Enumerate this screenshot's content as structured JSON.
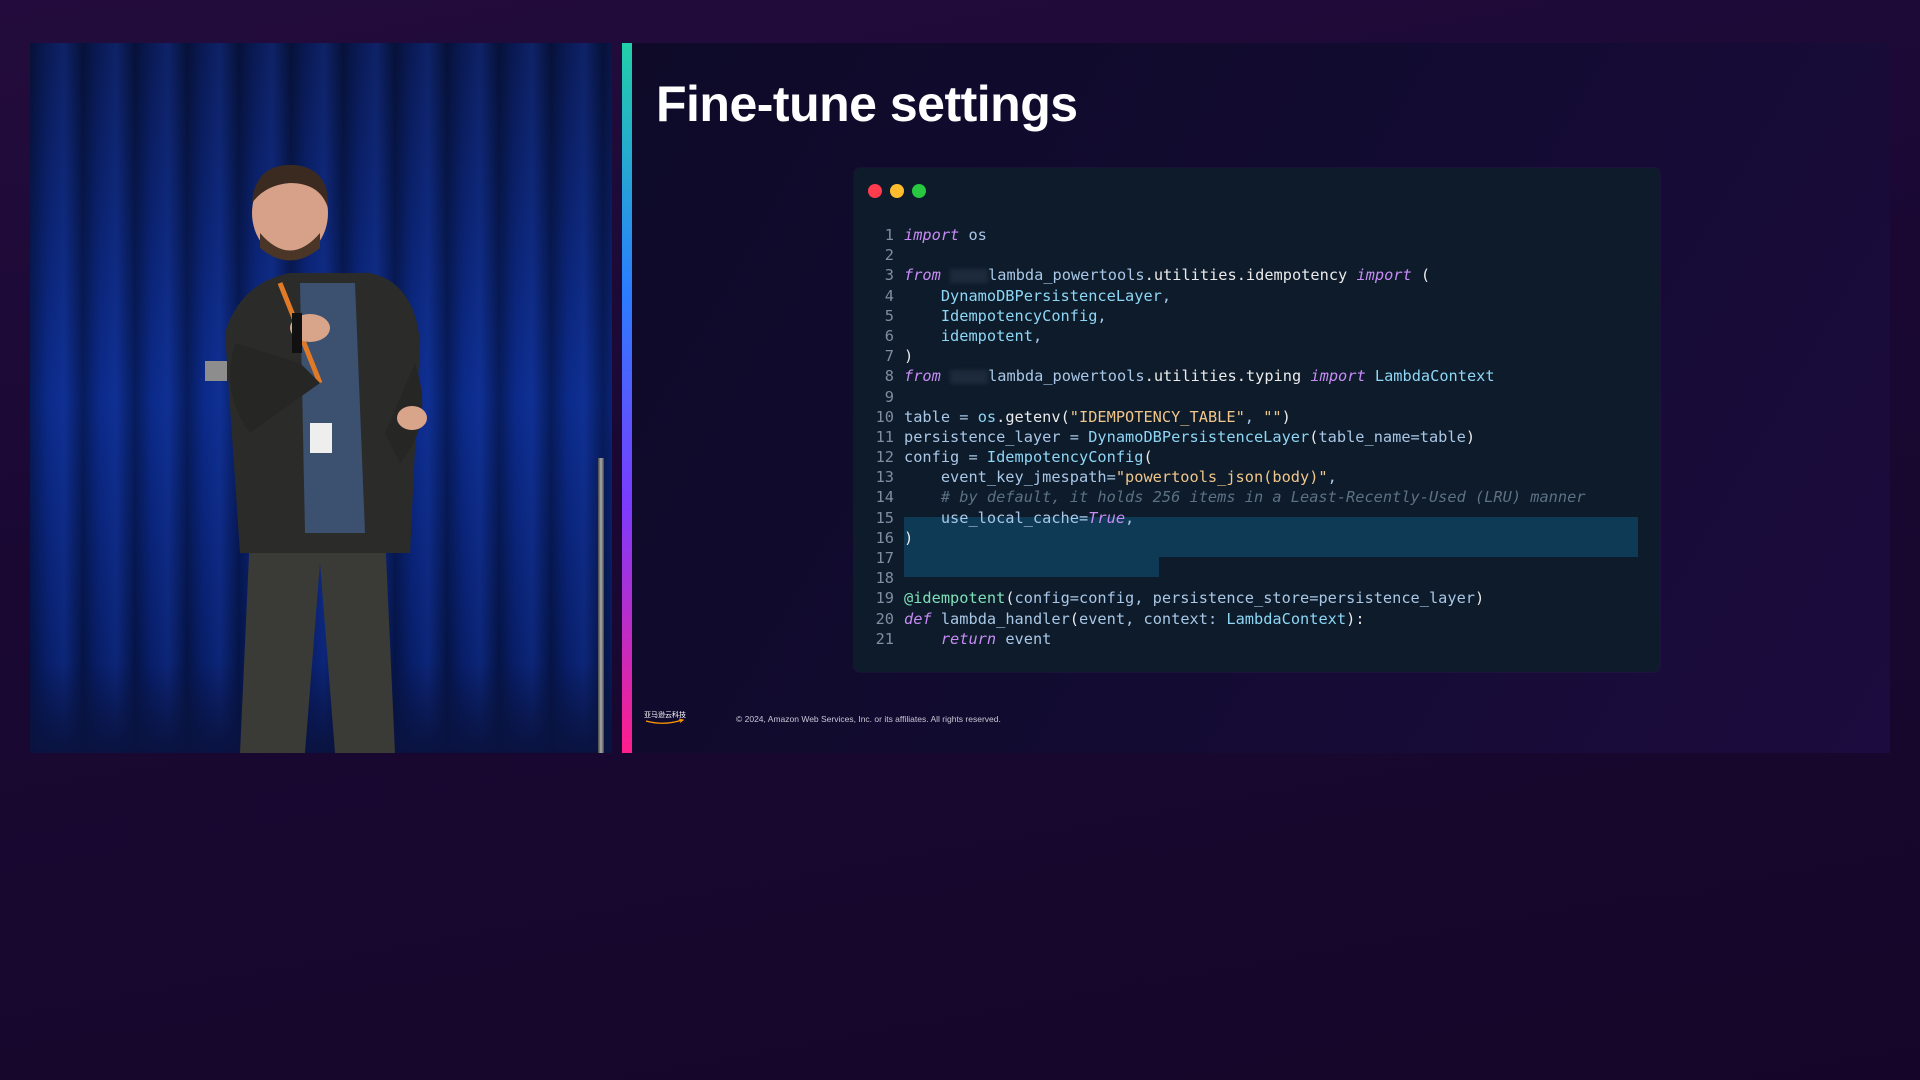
{
  "slide": {
    "title": "Fine-tune settings",
    "footer_logo_text": "亚马逊云科技",
    "copyright": "© 2024, Amazon Web Services, Inc. or its affiliates. All rights reserved."
  },
  "window_dots": {
    "colors": [
      "#ff3b4e",
      "#ffbd2e",
      "#28c840"
    ]
  },
  "code": {
    "lines": [
      {
        "n": "1",
        "tokens": [
          [
            "kw",
            "import"
          ],
          [
            "plain",
            " os"
          ]
        ]
      },
      {
        "n": "2",
        "tokens": []
      },
      {
        "n": "3",
        "tokens": [
          [
            "kw",
            "from"
          ],
          [
            "plain",
            " "
          ],
          [
            "blur",
            ""
          ],
          [
            "plain",
            "lambda_powertools"
          ],
          [
            "fn",
            ".utilities.idempotency "
          ],
          [
            "kw",
            "import"
          ],
          [
            "fn",
            " ("
          ]
        ]
      },
      {
        "n": "4",
        "tokens": [
          [
            "cls",
            "    DynamoDBPersistenceLayer"
          ],
          [
            "plain",
            ","
          ]
        ]
      },
      {
        "n": "5",
        "tokens": [
          [
            "cls",
            "    IdempotencyConfig"
          ],
          [
            "plain",
            ","
          ]
        ]
      },
      {
        "n": "6",
        "tokens": [
          [
            "cls",
            "    idempotent"
          ],
          [
            "plain",
            ","
          ]
        ]
      },
      {
        "n": "7",
        "tokens": [
          [
            "fn",
            ")"
          ]
        ]
      },
      {
        "n": "8",
        "tokens": [
          [
            "kw",
            "from"
          ],
          [
            "plain",
            " "
          ],
          [
            "blur",
            ""
          ],
          [
            "plain",
            "lambda_powertools"
          ],
          [
            "fn",
            ".utilities.typing "
          ],
          [
            "kw",
            "import"
          ],
          [
            "cls",
            " LambdaContext"
          ]
        ]
      },
      {
        "n": "9",
        "tokens": []
      },
      {
        "n": "10",
        "tokens": [
          [
            "plain",
            "table = "
          ],
          [
            "cls",
            "os"
          ],
          [
            "fn",
            ".getenv("
          ],
          [
            "str",
            "\"IDEMPOTENCY_TABLE\""
          ],
          [
            "plain",
            ", "
          ],
          [
            "str",
            "\"\""
          ],
          [
            "fn",
            ")"
          ]
        ]
      },
      {
        "n": "11",
        "tokens": [
          [
            "plain",
            "persistence_layer = "
          ],
          [
            "cls",
            "DynamoDBPersistenceLayer"
          ],
          [
            "fn",
            "("
          ],
          [
            "plain",
            "table_name=table"
          ],
          [
            "fn",
            ")"
          ]
        ]
      },
      {
        "n": "12",
        "tokens": [
          [
            "plain",
            "config = "
          ],
          [
            "cls",
            "IdempotencyConfig"
          ],
          [
            "fn",
            "("
          ]
        ]
      },
      {
        "n": "13",
        "tokens": [
          [
            "plain",
            "    event_key_jmespath="
          ],
          [
            "str",
            "\"powertools_json(body)\""
          ],
          [
            "plain",
            ","
          ]
        ]
      },
      {
        "n": "14",
        "tokens": [
          [
            "cm",
            "    # by default, it holds 256 items in a Least-Recently-Used (LRU) manner"
          ]
        ]
      },
      {
        "n": "15",
        "tokens": [
          [
            "plain",
            "    use_local_cache="
          ],
          [
            "kw",
            "True"
          ],
          [
            "plain",
            ","
          ]
        ]
      },
      {
        "n": "16",
        "tokens": [
          [
            "fn",
            ")"
          ]
        ]
      },
      {
        "n": "17",
        "tokens": []
      },
      {
        "n": "18",
        "tokens": []
      },
      {
        "n": "19",
        "tokens": [
          [
            "dec",
            "@idempotent"
          ],
          [
            "fn",
            "("
          ],
          [
            "plain",
            "config=config, persistence_store=persistence_layer"
          ],
          [
            "fn",
            ")"
          ]
        ]
      },
      {
        "n": "20",
        "tokens": [
          [
            "kw",
            "def"
          ],
          [
            "plain",
            " lambda_handler"
          ],
          [
            "fn",
            "("
          ],
          [
            "plain",
            "event, context: "
          ],
          [
            "cls",
            "LambdaContext"
          ],
          [
            "fn",
            "):"
          ]
        ]
      },
      {
        "n": "21",
        "tokens": [
          [
            "kw",
            "    return"
          ],
          [
            "plain",
            " event"
          ]
        ]
      }
    ]
  }
}
